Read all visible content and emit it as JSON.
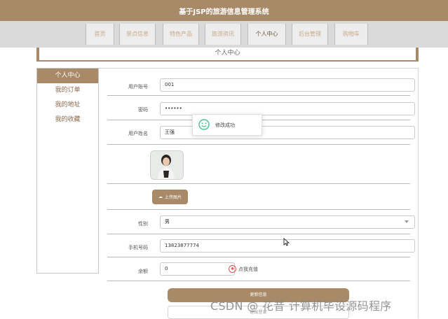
{
  "header": {
    "title": "基于JSP的旅游信息管理系统"
  },
  "nav": {
    "items": [
      {
        "label": "首页"
      },
      {
        "label": "景点信息"
      },
      {
        "label": "特色产品"
      },
      {
        "label": "旅游资讯"
      },
      {
        "label": "个人中心",
        "active": true
      },
      {
        "label": "后台管理"
      },
      {
        "label": "购物车"
      }
    ]
  },
  "page_title": "个人中心",
  "sidebar": {
    "items": [
      {
        "label": "个人中心",
        "active": true
      },
      {
        "label": "我的订单"
      },
      {
        "label": "我的地址"
      },
      {
        "label": "我的收藏"
      }
    ]
  },
  "form": {
    "account": {
      "label": "用户账号",
      "value": "001"
    },
    "password": {
      "label": "密码",
      "value": "••••••"
    },
    "name": {
      "label": "用户姓名",
      "value": "王强"
    },
    "upload_label": "上传图片",
    "gender": {
      "label": "性别",
      "value": "男"
    },
    "phone": {
      "label": "手机号码",
      "value": "13823877774"
    },
    "balance": {
      "label": "余额",
      "value": "0"
    },
    "recharge_label": "点我充值",
    "update_label": "更新信息",
    "logout_label": "退出登录"
  },
  "toast": {
    "message": "修改成功"
  },
  "watermark": "CSDN @ 花昔 计算机毕设源码程序",
  "colors": {
    "accent": "#a88a68",
    "toast_icon": "#4cbf8f",
    "recharge_icon": "#e05252"
  }
}
